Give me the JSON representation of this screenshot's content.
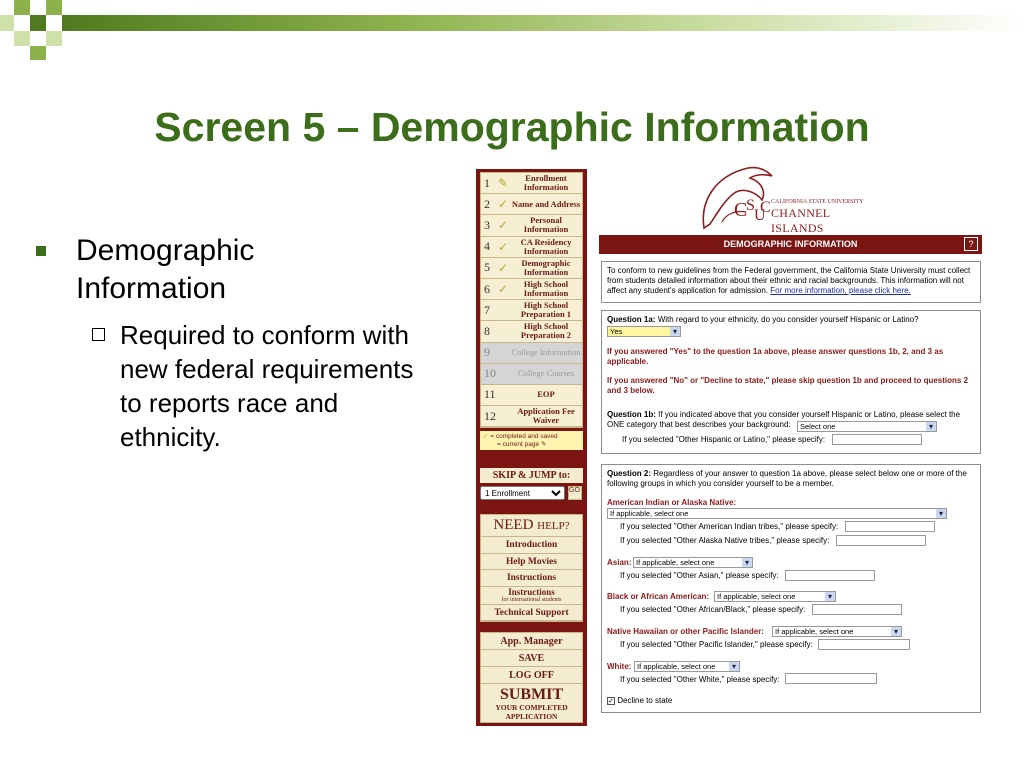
{
  "slide": {
    "title": "Screen 5 – Demographic Information",
    "bullet": "Demographic Information",
    "sub_bullet": "Required to conform with new federal requirements to reports race and ethnicity."
  },
  "colors": {
    "title_green": "#3b6d1a",
    "maroon": "#7a1512",
    "panel_bg": "#f3ecd0"
  },
  "sidebar": {
    "steps": [
      {
        "num": "1",
        "label": "Enrollment Information",
        "state": "current",
        "icon": "pencil-icon"
      },
      {
        "num": "2",
        "label": "Name and Address",
        "state": "completed",
        "icon": "check-icon"
      },
      {
        "num": "3",
        "label": "Personal Information",
        "state": "completed",
        "icon": "check-icon"
      },
      {
        "num": "4",
        "label": "CA Residency Information",
        "state": "completed",
        "icon": "check-icon"
      },
      {
        "num": "5",
        "label": "Demographic Information",
        "state": "completed",
        "icon": "check-icon"
      },
      {
        "num": "6",
        "label": "High School Information",
        "state": "completed",
        "icon": "check-icon"
      },
      {
        "num": "7",
        "label": "High School Preparation 1",
        "state": "open",
        "icon": ""
      },
      {
        "num": "8",
        "label": "High School Preparation 2",
        "state": "open",
        "icon": ""
      },
      {
        "num": "9",
        "label": "College Information",
        "state": "disabled",
        "icon": ""
      },
      {
        "num": "10",
        "label": "College Courses",
        "state": "disabled",
        "icon": ""
      },
      {
        "num": "11",
        "label": "EOP",
        "state": "open",
        "icon": ""
      },
      {
        "num": "12",
        "label": "Application Fee Waiver",
        "state": "open",
        "icon": ""
      }
    ],
    "legend_line1": "= completed and saved",
    "legend_line2": "= current page",
    "skip_header": "SKIP & JUMP to:",
    "skip_selected": "1 Enrollment",
    "go_label": "GO",
    "help_header_a": "NEED",
    "help_header_b": "HELP?",
    "help_items": [
      "Introduction",
      "Help Movies",
      "Instructions"
    ],
    "help_intl_main": "Instructions",
    "help_intl_sub": "for international students",
    "help_support": "Technical Support",
    "app_manager": "App. Manager",
    "save": "SAVE",
    "log_off": "LOG OFF",
    "submit_big": "SUBMIT",
    "submit_line1": "YOUR COMPLETED",
    "submit_line2": "APPLICATION"
  },
  "logo": {
    "university": "CALIFORNIA STATE UNIVERSITY",
    "campus": "CHANNEL ISLANDS"
  },
  "form": {
    "banner": "DEMOGRAPHIC INFORMATION",
    "help_mark": "?",
    "intro": "To conform to new guidelines from the Federal government, the California State University must collect from students detailed information about their ethnic and racial backgrounds. This information will not affect any student's application for admission.",
    "intro_link": "For more information, please click here.",
    "q1a_label": "Question 1a:",
    "q1a_text": "With regard to your ethnicity, do you consider yourself Hispanic or Latino?",
    "q1a_value": "Yes",
    "note_yes": "If you answered \"Yes\" to the question 1a above, please answer questions 1b, 2, and 3 as applicable.",
    "note_no": "If you answered \"No\" or \"Decline to state,\" please skip question 1b and proceed to questions 2 and 3 below.",
    "q1b_label": "Question 1b:",
    "q1b_text": "If you indicated above that you consider yourself Hispanic or Latino, please select the ONE category that best describes your background:",
    "q1b_value": "Select one",
    "q1b_other": "If you selected \"Other Hispanic or Latino,\" please specify:",
    "q2_label": "Question 2:",
    "q2_text": "Regardless of your answer to question 1a above, please select below one or more of the following groups in which you consider yourself to be a member.",
    "amind_label": "American Indian or Alaska Native:",
    "amind_value": "If applicable, select one",
    "amind_other1": "If you selected \"Other American Indian tribes,\" please specify:",
    "amind_other2": "If you selected \"Other Alaska Native tribes,\" please specify:",
    "asian_label": "Asian:",
    "asian_value": "If applicable, select one",
    "asian_other": "If you selected \"Other Asian,\" please specify:",
    "black_label": "Black or African American:",
    "black_value": "If applicable, select one",
    "black_other": "If you selected \"Other African/Black,\" please specify:",
    "nhpi_label": "Native Hawaiian or other Pacific Islander:",
    "nhpi_value": "If applicable, select one",
    "nhpi_other": "If you selected \"Other Pacific Islander,\" please specify:",
    "white_label": "White:",
    "white_value": "If applicable, select one",
    "white_other": "If you selected \"Other White,\" please specify:",
    "decline_label": "Decline to state",
    "decline_checked": true
  }
}
